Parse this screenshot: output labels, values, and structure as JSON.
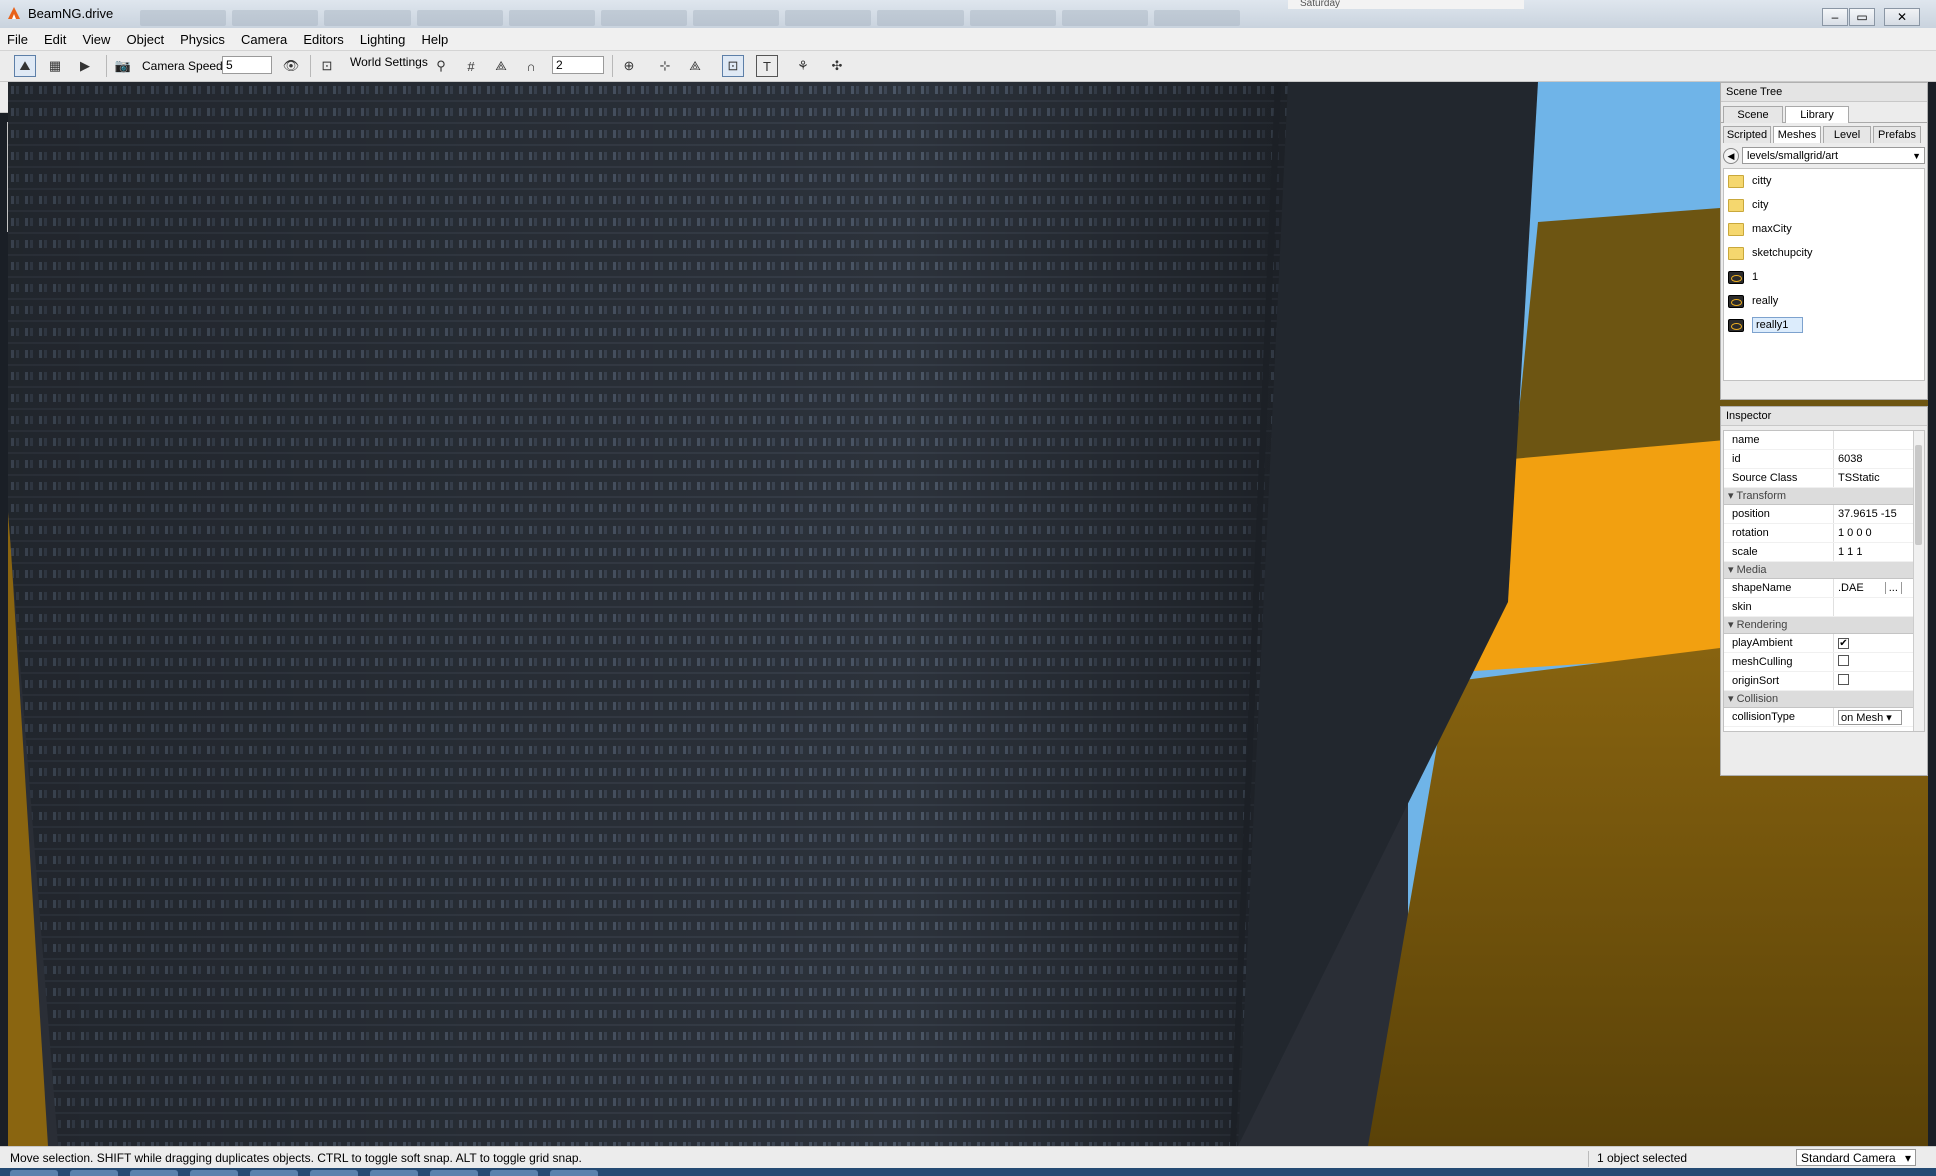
{
  "window": {
    "title": "BeamNG.drive",
    "calendar_day": "Saturday"
  },
  "menu": [
    "File",
    "Edit",
    "View",
    "Object",
    "Physics",
    "Camera",
    "Editors",
    "Lighting",
    "Help"
  ],
  "toolbar": {
    "camera_speed_label": "Camera Speed",
    "camera_speed_value": "5",
    "world_settings_label": "World Settings",
    "grid_value": "2"
  },
  "scene_tree": {
    "title": "Scene Tree",
    "tabs": [
      "Scene",
      "Library"
    ],
    "active_tab": "Library",
    "subtabs": [
      "Scripted",
      "Meshes",
      "Level",
      "Prefabs"
    ],
    "active_subtab": "Meshes",
    "path": "levels/smallgrid/art",
    "items": [
      {
        "label": "citty",
        "type": "folder"
      },
      {
        "label": "city",
        "type": "folder"
      },
      {
        "label": "maxCity",
        "type": "folder"
      },
      {
        "label": "sketchupcity",
        "type": "folder"
      },
      {
        "label": "1",
        "type": "mesh"
      },
      {
        "label": "really",
        "type": "mesh"
      },
      {
        "label": "really1",
        "type": "mesh",
        "selected": true
      }
    ]
  },
  "inspector": {
    "title": "Inspector",
    "rows": {
      "name": {
        "label": "name",
        "value": ""
      },
      "id": {
        "label": "id",
        "value": "6038"
      },
      "source_class": {
        "label": "Source Class",
        "value": "TSStatic"
      }
    },
    "transform": {
      "title": "Transform",
      "position": {
        "label": "position",
        "value": "37.9615 -15"
      },
      "rotation": {
        "label": "rotation",
        "value": "1 0 0 0"
      },
      "scale": {
        "label": "scale",
        "value": "1 1 1"
      }
    },
    "media": {
      "title": "Media",
      "shape_name": {
        "label": "shapeName",
        "value": ".DAE",
        "browse": "..."
      },
      "skin": {
        "label": "skin",
        "value": ""
      }
    },
    "rendering": {
      "title": "Rendering",
      "play_ambient": {
        "label": "playAmbient",
        "checked": true
      },
      "mesh_culling": {
        "label": "meshCulling",
        "checked": false
      },
      "origin_sort": {
        "label": "originSort",
        "checked": false
      }
    },
    "collision": {
      "title": "Collision",
      "collision_type": {
        "label": "collisionType",
        "value": "on Mesh"
      }
    }
  },
  "status": {
    "message": "Move selection.  SHIFT while dragging duplicates objects.  CTRL to toggle soft snap.  ALT to toggle grid snap.",
    "selection": "1 object selected",
    "camera_mode": "Standard Camera"
  },
  "colors": {
    "accent_orange": "#f0a010",
    "building": "#2c323b",
    "sky": "#6fb4e8"
  }
}
